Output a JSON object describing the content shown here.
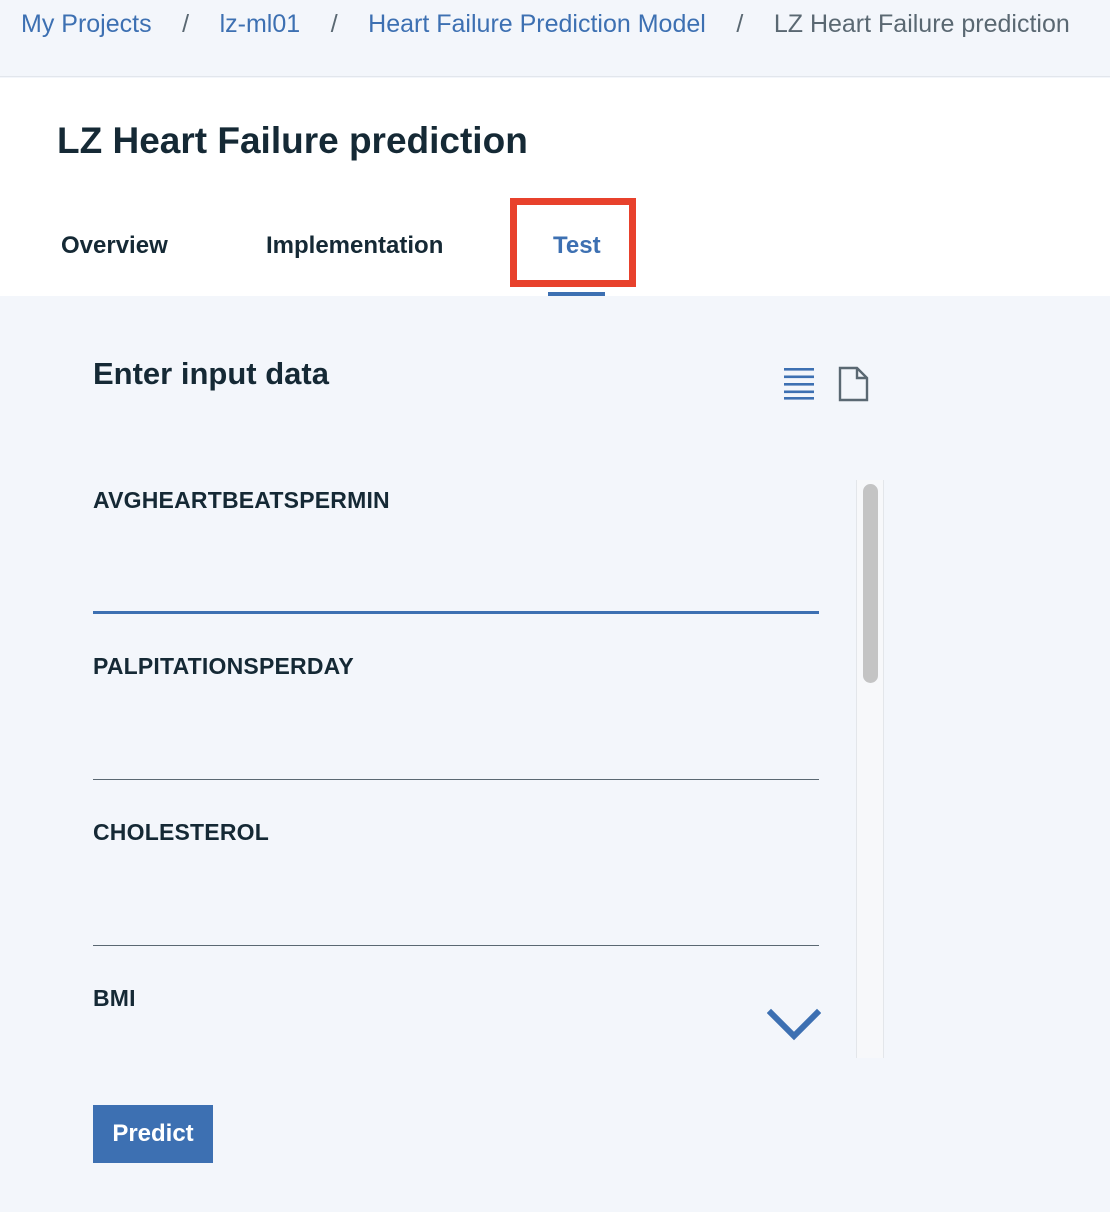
{
  "breadcrumb": {
    "items": [
      "My Projects",
      "lz-ml01",
      "Heart Failure Prediction Model"
    ],
    "separator": "/",
    "current": "LZ Heart Failure prediction"
  },
  "page": {
    "title": "LZ Heart Failure prediction"
  },
  "tabs": [
    {
      "label": "Overview",
      "active": false
    },
    {
      "label": "Implementation",
      "active": false
    },
    {
      "label": "Test",
      "active": true,
      "highlighted": true
    }
  ],
  "panel": {
    "title": "Enter input data",
    "view_icons": [
      "list-view-icon",
      "file-icon"
    ]
  },
  "fields": [
    {
      "label": "AVGHEARTBEATSPERMIN",
      "value": "",
      "focused": true
    },
    {
      "label": "PALPITATIONSPERDAY",
      "value": ""
    },
    {
      "label": "CHOLESTEROL",
      "value": ""
    },
    {
      "label": "BMI",
      "value": ""
    }
  ],
  "actions": {
    "predict_label": "Predict"
  },
  "colors": {
    "accent": "#3d70b2",
    "highlight": "#e8412c",
    "text": "#152935",
    "background": "#f3f6fb"
  }
}
